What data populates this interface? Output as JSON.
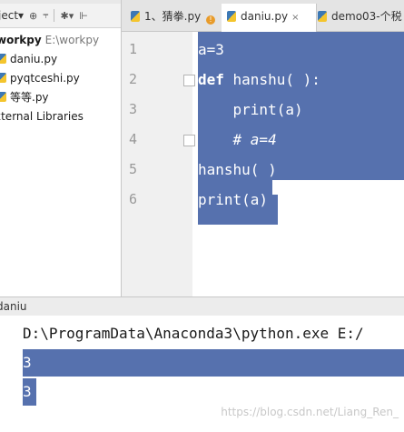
{
  "project_panel": {
    "toolbar_label": "ject▾",
    "toolbar_icons": [
      "target-icon",
      "split-icon",
      "gear-icon",
      "collapse-icon"
    ],
    "root_name": "workpy",
    "root_path": "E:\\workpy",
    "files": [
      "daniu.py",
      "pyqtceshi.py",
      "等等.py"
    ],
    "external_libraries": "xternal Libraries"
  },
  "tabs": [
    {
      "label": "1、猜拳.py",
      "active": false
    },
    {
      "label": "daniu.py",
      "active": true
    },
    {
      "label": "demo03-个税",
      "active": false
    }
  ],
  "tab_close": "×",
  "editor": {
    "line_numbers": [
      "1",
      "2",
      "3",
      "4",
      "5",
      "6"
    ],
    "lines": [
      {
        "text": "a=3"
      },
      {
        "keyword": "def",
        "text": " hanshu( ):"
      },
      {
        "text": "    print(a)"
      },
      {
        "text": "    # a=4",
        "comment": true
      },
      {
        "text": "hanshu( )"
      },
      {
        "text": "print(a)"
      }
    ]
  },
  "run_panel": {
    "tab_label": "daniu",
    "output": [
      "D:\\ProgramData\\Anaconda3\\python.exe E:/",
      "3",
      "3"
    ]
  },
  "watermark": "https://blog.csdn.net/Liang_Ren_",
  "colors": {
    "selection": "#5671ae",
    "gutter": "#f0f0f0"
  }
}
